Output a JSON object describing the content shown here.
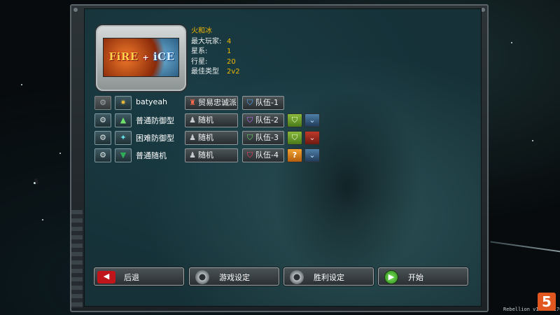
{
  "map": {
    "thumbnail_text_fire": "FiRE",
    "thumbnail_text_plus": "+",
    "thumbnail_text_ice": "iCE",
    "name": "火和冰",
    "info": [
      {
        "key": "最大玩家:",
        "value": "4"
      },
      {
        "key": "星系:",
        "value": "1"
      },
      {
        "key": "行星:",
        "value": "20"
      },
      {
        "key": "最佳类型",
        "value": "2v2"
      }
    ]
  },
  "players": [
    {
      "name": "batyeah",
      "race_icon": "gold-emblem-icon",
      "faction": "贸易忠诚派",
      "faction_icon": "trade-faction-icon",
      "team": "队伍-1",
      "team_color": "blue",
      "ai_buttons": []
    },
    {
      "name": "普通防御型",
      "race_icon": "green-arrow-up-icon",
      "faction": "随机",
      "faction_icon": "random-silhouette-icon",
      "team": "队伍-2",
      "team_color": "purple",
      "ai_buttons": [
        "green",
        "blue"
      ]
    },
    {
      "name": "困难防御型",
      "race_icon": "cyan-emblem-icon",
      "faction": "随机",
      "faction_icon": "random-silhouette-icon",
      "team": "队伍-3",
      "team_color": "green",
      "ai_buttons": [
        "green",
        "red"
      ]
    },
    {
      "name": "普通随机",
      "race_icon": "green-arrow-down-icon",
      "faction": "随机",
      "faction_icon": "random-silhouette-icon",
      "team": "队伍-4",
      "team_color": "crimson",
      "ai_buttons": [
        "orange",
        "blue"
      ]
    }
  ],
  "buttons": {
    "back": "后退",
    "game_settings": "游戏设定",
    "victory_settings": "胜利设定",
    "start": "开始"
  },
  "version": "Rebellion v1.01.4176",
  "logo": "5"
}
